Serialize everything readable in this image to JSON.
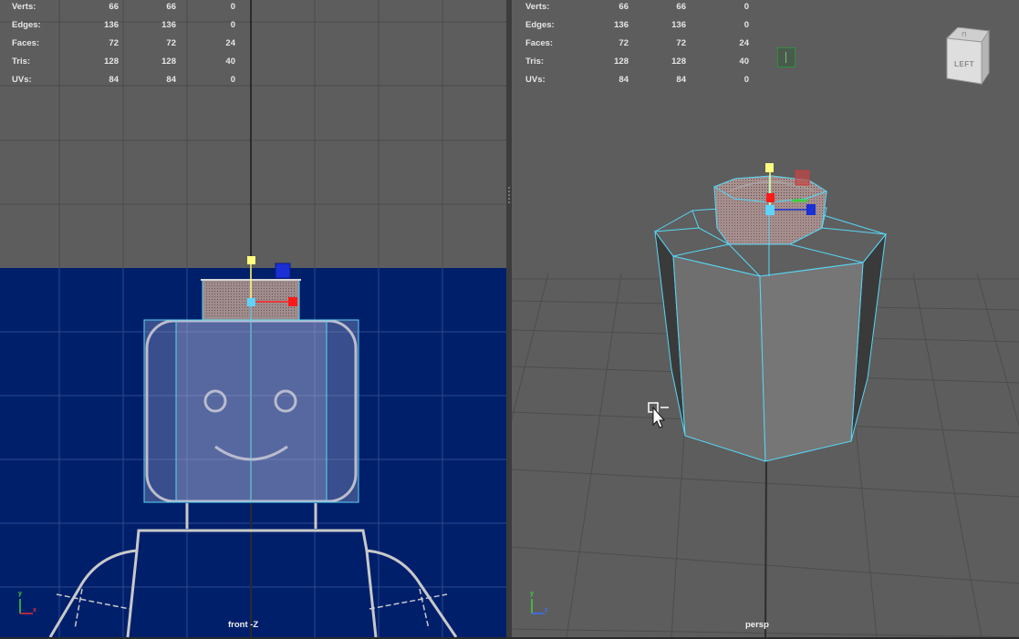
{
  "hud": {
    "rows": [
      {
        "label": "Verts:",
        "v1": "66",
        "v2": "66",
        "v3": "0"
      },
      {
        "label": "Edges:",
        "v1": "136",
        "v2": "136",
        "v3": "0"
      },
      {
        "label": "Faces:",
        "v1": "72",
        "v2": "72",
        "v3": "24"
      },
      {
        "label": "Tris:",
        "v1": "128",
        "v2": "128",
        "v3": "40"
      },
      {
        "label": "UVs:",
        "v1": "84",
        "v2": "84",
        "v3": "0"
      }
    ]
  },
  "viewports": {
    "left": {
      "camera": "front -Z",
      "axis_y": "y",
      "axis_h": "x"
    },
    "right": {
      "camera": "persp",
      "axis_y": "y",
      "axis_h": "z",
      "viewcube_face": "LEFT"
    }
  },
  "colors": {
    "viewport_bg": "#5d5d5d",
    "image_plane": "#001f6b",
    "wire_highlight": "#58d7f5",
    "manip_y": "#ffff80",
    "manip_x": "#ff2020",
    "manip_z": "#1a2fd4",
    "manip_center": "#5fd3ff"
  }
}
